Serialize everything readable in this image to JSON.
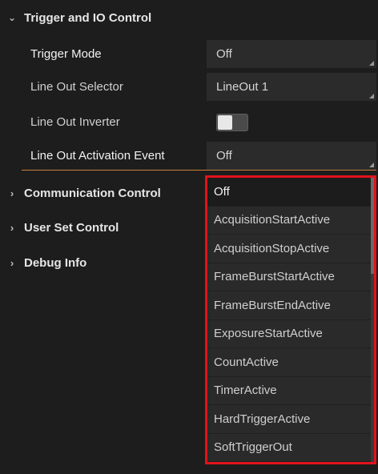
{
  "section": {
    "title": "Trigger and IO Control",
    "expand_icon": "chevron-down-icon"
  },
  "properties": [
    {
      "label": "Trigger Mode",
      "value": "Off"
    },
    {
      "label": "Line Out Selector",
      "value": "LineOut 1"
    },
    {
      "label": "Line Out Inverter",
      "value_type": "toggle",
      "value": false
    },
    {
      "label": "Line Out Activation Event",
      "value": "Off"
    }
  ],
  "collapsed_sections": [
    {
      "title": "Communication Control",
      "icon": "chevron-right-icon"
    },
    {
      "title": "User Set Control",
      "icon": "chevron-right-icon"
    },
    {
      "title": "Debug Info",
      "icon": "chevron-right-icon"
    }
  ],
  "dropdown": {
    "selected": "Off",
    "options": [
      "Off",
      "AcquisitionStartActive",
      "AcquisitionStopActive",
      "FrameBurstStartActive",
      "FrameBurstEndActive",
      "ExposureStartActive",
      "CountActive",
      "TimerActive",
      "HardTriggerActive",
      "SoftTriggerOut"
    ],
    "highlight_color": "#e1131b"
  },
  "colors": {
    "accent_underline": "#c9803a",
    "background": "#1d1d1d"
  }
}
